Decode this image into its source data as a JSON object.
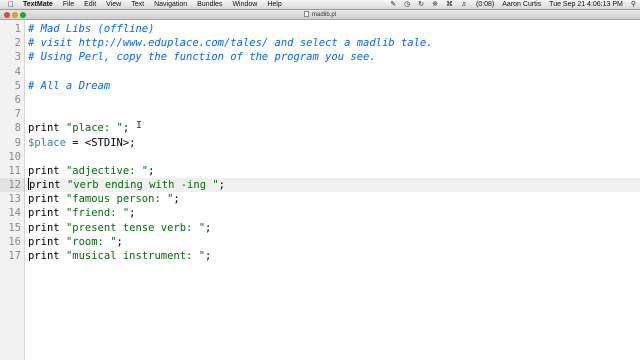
{
  "menubar": {
    "apple_icon": "apple-logo-icon",
    "app_name": "TextMate",
    "items": [
      "File",
      "Edit",
      "View",
      "Text",
      "Navigation",
      "Bundles",
      "Window",
      "Help"
    ],
    "status_icons": [
      "script-icon",
      "clock-icon",
      "sync-icon",
      "bluetooth-icon",
      "wifi-icon",
      "volume-icon"
    ],
    "battery": "(0:08)",
    "user": "Aaron Curtis",
    "datetime": "Tue Sep 21  4:06:13 PM",
    "spotlight_icon": "magnifier-icon"
  },
  "window": {
    "title": "madlib.pl"
  },
  "editor": {
    "current_line": 12,
    "lines": [
      {
        "n": "1",
        "segments": [
          {
            "t": "# Mad Libs (offline)",
            "c": "comment"
          }
        ]
      },
      {
        "n": "2",
        "segments": [
          {
            "t": "# visit http://www.eduplace.com/tales/ and select a madlib tale.",
            "c": "comment"
          }
        ]
      },
      {
        "n": "3",
        "segments": [
          {
            "t": "# Using Perl, copy the function of the program you see.",
            "c": "comment"
          }
        ]
      },
      {
        "n": "4",
        "segments": []
      },
      {
        "n": "5",
        "segments": [
          {
            "t": "# All a Dream",
            "c": "comment"
          }
        ]
      },
      {
        "n": "6",
        "segments": []
      },
      {
        "n": "7",
        "segments": []
      },
      {
        "n": "8",
        "segments": [
          {
            "t": "print ",
            "c": "kw"
          },
          {
            "t": "\"place: \"",
            "c": "str"
          },
          {
            "t": ";",
            "c": "plain"
          }
        ]
      },
      {
        "n": "9",
        "segments": [
          {
            "t": "$place",
            "c": "var"
          },
          {
            "t": " = <STDIN>;",
            "c": "plain"
          }
        ]
      },
      {
        "n": "10",
        "segments": []
      },
      {
        "n": "11",
        "segments": [
          {
            "t": "print ",
            "c": "kw"
          },
          {
            "t": "\"adjective: \"",
            "c": "str"
          },
          {
            "t": ";",
            "c": "plain"
          }
        ]
      },
      {
        "n": "12",
        "segments": [
          {
            "t": "print ",
            "c": "kw"
          },
          {
            "t": "\"verb ending with -ing \"",
            "c": "str"
          },
          {
            "t": ";",
            "c": "plain"
          }
        ]
      },
      {
        "n": "13",
        "segments": [
          {
            "t": "print ",
            "c": "kw"
          },
          {
            "t": "\"famous person: \"",
            "c": "str"
          },
          {
            "t": ";",
            "c": "plain"
          }
        ]
      },
      {
        "n": "14",
        "segments": [
          {
            "t": "print ",
            "c": "kw"
          },
          {
            "t": "\"friend: \"",
            "c": "str"
          },
          {
            "t": ";",
            "c": "plain"
          }
        ]
      },
      {
        "n": "15",
        "segments": [
          {
            "t": "print ",
            "c": "kw"
          },
          {
            "t": "\"present tense verb: \"",
            "c": "str"
          },
          {
            "t": ";",
            "c": "plain"
          }
        ]
      },
      {
        "n": "16",
        "segments": [
          {
            "t": "print ",
            "c": "kw"
          },
          {
            "t": "\"room: \"",
            "c": "str"
          },
          {
            "t": ";",
            "c": "plain"
          }
        ]
      },
      {
        "n": "17",
        "segments": [
          {
            "t": "print ",
            "c": "kw"
          },
          {
            "t": "\"musical instrument: \"",
            "c": "str"
          },
          {
            "t": ";",
            "c": "plain"
          }
        ]
      }
    ]
  }
}
